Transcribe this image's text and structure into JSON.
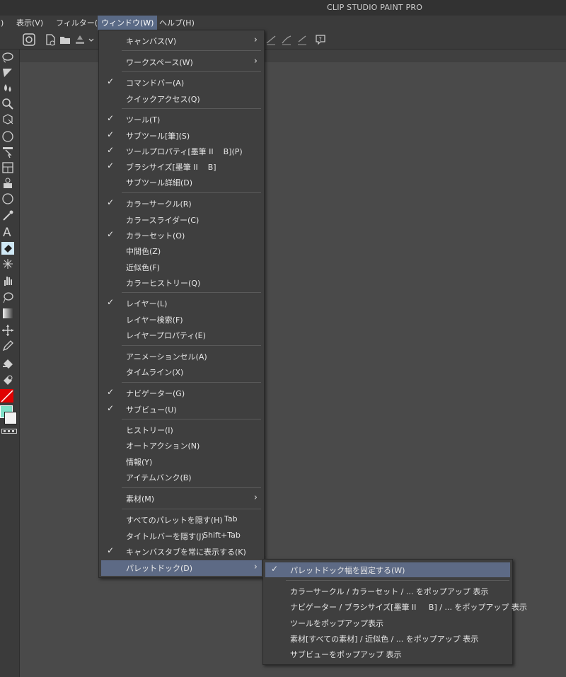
{
  "app_title": "CLIP STUDIO PAINT PRO",
  "menubar": {
    "partial_left": ")",
    "view": "表示(V)",
    "filter": "フィルター(I)",
    "window": "ウィンドウ(W)",
    "help": "ヘルプ(H)"
  },
  "window_menu": {
    "canvas": "キャンバス(V)",
    "workspace": "ワークスペース(W)",
    "command_bar": "コマンドバー(A)",
    "quick_access": "クイックアクセス(Q)",
    "tool": "ツール(T)",
    "sub_tool": "サブツール[筆](S)",
    "tool_property": "ツールプロパティ[墨筆 II    B](P)",
    "brush_size": "ブラシサイズ[墨筆 II    B]",
    "sub_tool_detail": "サブツール詳細(D)",
    "color_wheel": "カラーサークル(R)",
    "color_slider": "カラースライダー(C)",
    "color_set": "カラーセット(O)",
    "intermediate_color": "中間色(Z)",
    "approximate_color": "近似色(F)",
    "color_history": "カラーヒストリー(Q)",
    "layer": "レイヤー(L)",
    "layer_search": "レイヤー検索(F)",
    "layer_property": "レイヤープロパティ(E)",
    "animation_cels": "アニメーションセル(A)",
    "timeline": "タイムライン(X)",
    "navigator": "ナビゲーター(G)",
    "sub_view": "サブビュー(U)",
    "history": "ヒストリー(I)",
    "auto_action": "オートアクション(N)",
    "info": "情報(Y)",
    "item_bank": "アイテムバンク(B)",
    "material": "素材(M)",
    "hide_all_palettes": "すべてのパレットを隠す(H)",
    "hide_all_palettes_shortcut": "Tab",
    "hide_title_bar": "タイトルバーを隠す(J)",
    "hide_title_bar_shortcut": "Shift+Tab",
    "always_show_canvas_tab": "キャンバスタブを常に表示する(K)",
    "palette_dock": "パレットドック(D)",
    "check_mark": "✓",
    "submenu_arrow": "›"
  },
  "palette_dock_submenu": {
    "fix_width": "パレットドック幅を固定する(W)",
    "popup_color": "カラーサークル / カラーセット / ... をポップアップ 表示",
    "popup_navigator": "ナビゲーター / ブラシサイズ[墨筆 II     B] / ... をポップアップ 表示",
    "popup_tool": "ツールをポップアップ表示",
    "popup_material": "素材[すべての素材] / 近似色 / ... をポップアップ 表示",
    "popup_subview": "サブビューをポップアップ 表示"
  },
  "colors": {
    "highlight": "#5d6a85",
    "main_color": "#e00000",
    "sub_color": "#7fe0c8"
  }
}
